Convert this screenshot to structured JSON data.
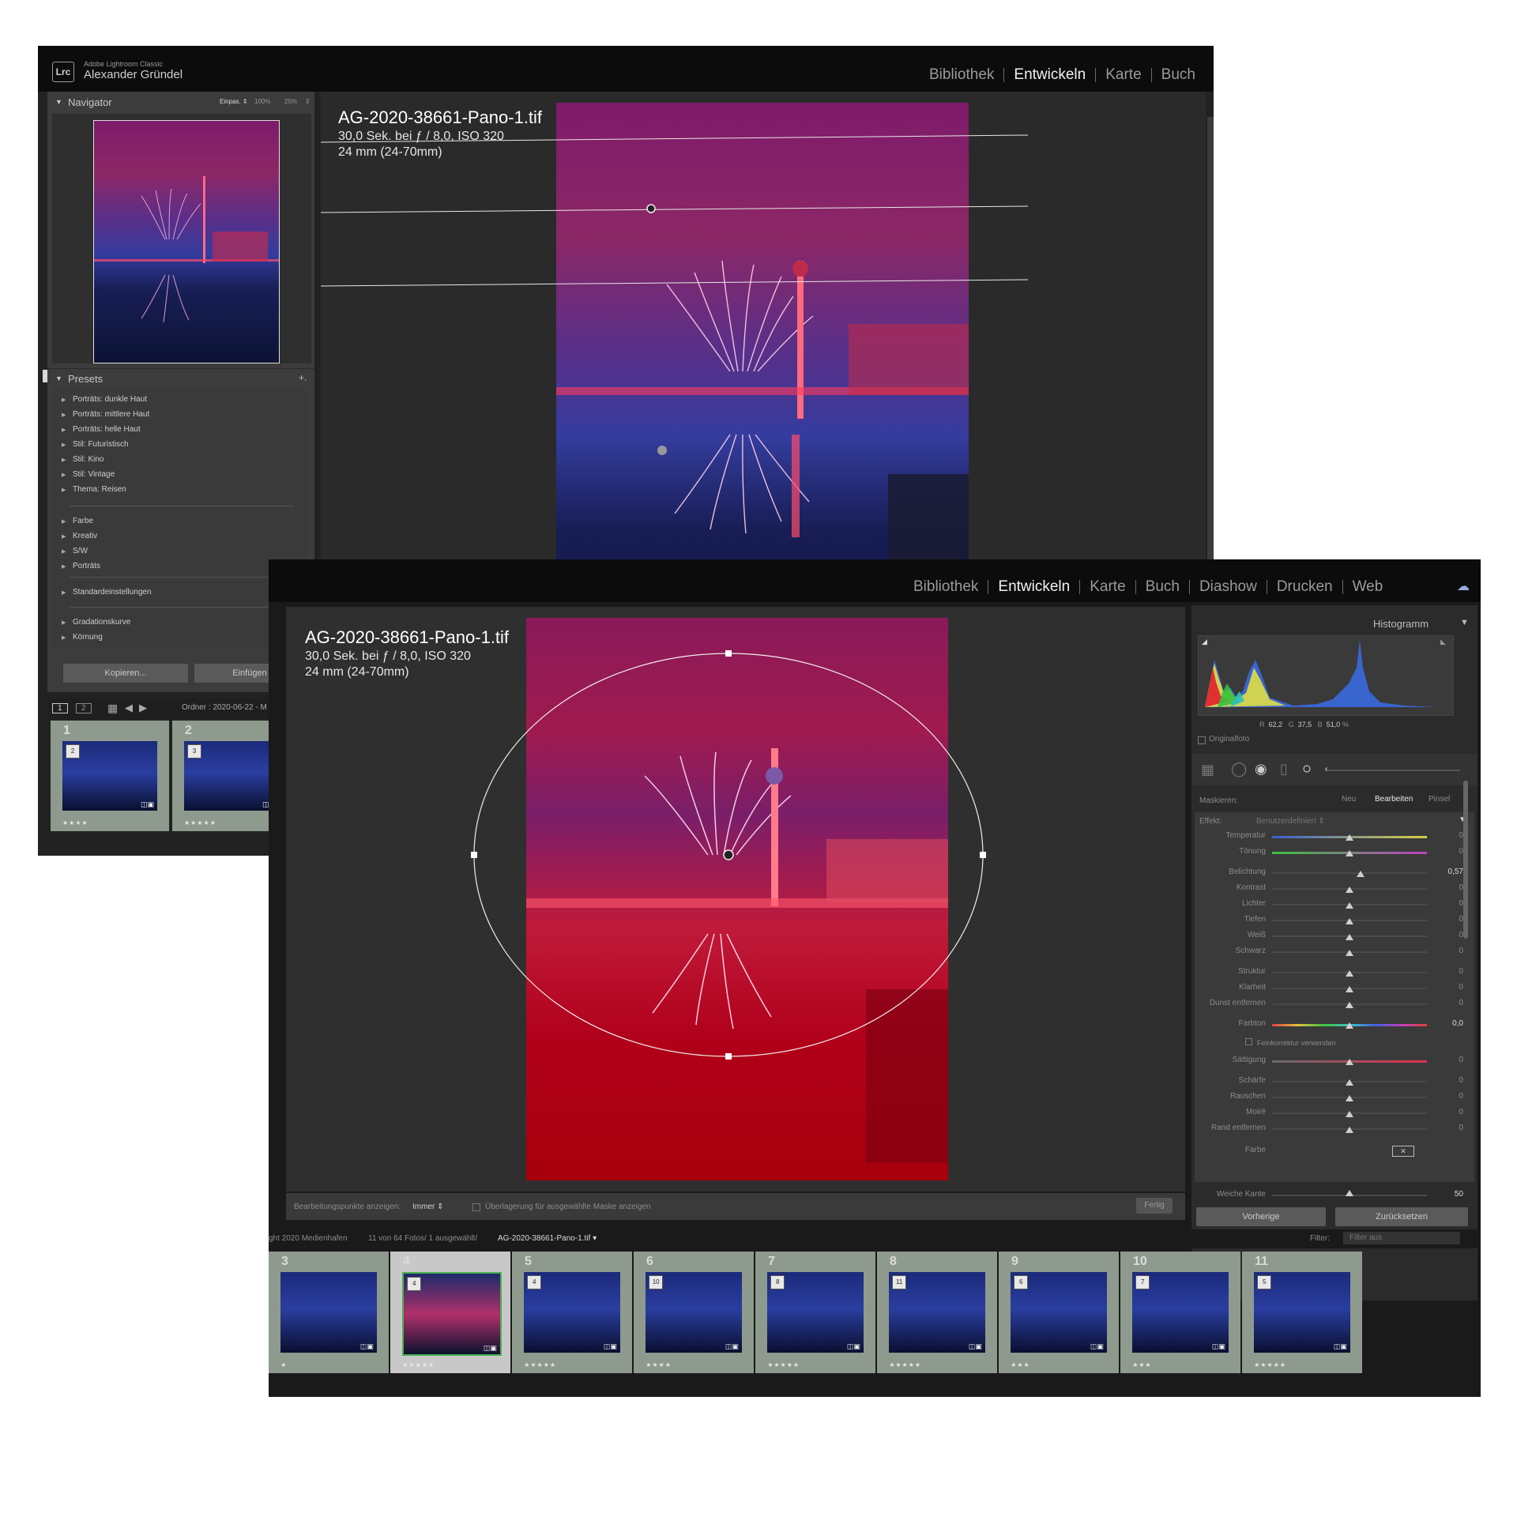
{
  "back_window": {
    "app_name": "Adobe Lightroom Classic",
    "user_name": "Alexander Gründel",
    "logo_text": "Lrc",
    "modules": [
      "Bibliothek",
      "Entwickeln",
      "Karte",
      "Buch"
    ],
    "active_module": "Entwickeln",
    "navigator": {
      "title": "Navigator",
      "zoom_fit": "Einpas. ⇕",
      "zoom_100": "100%",
      "zoom_25": "25%",
      "zoom_arrow": "⇕"
    },
    "presets": {
      "title": "Presets",
      "add_icon": "+.",
      "items_group1": [
        "Porträts: dunkle Haut",
        "Porträts: mittlere Haut",
        "Porträts: helle Haut",
        "Stil: Futuristisch",
        "Stil: Kino",
        "Stil: Vintage",
        "Thema: Reisen"
      ],
      "items_group2": [
        "Farbe",
        "Kreativ",
        "S/W",
        "Porträts"
      ],
      "items_group3": [
        "Standardeinstellungen"
      ],
      "items_group4": [
        "Gradationskurve",
        "Körnung"
      ]
    },
    "copy_button": "Kopieren...",
    "paste_button": "Einfügen",
    "filmstrip_bar": {
      "view1": "1",
      "view2": "2",
      "folder": "Ordner : 2020-06-22 - M"
    },
    "filmstrip": [
      {
        "number": "1",
        "badge": "2",
        "stars": "★★★★"
      },
      {
        "number": "2",
        "badge": "3",
        "stars": "★★★★★"
      }
    ],
    "file_name": "AG-2020-38661-Pano-1.tif",
    "exif_line1": "30,0 Sek. bei ƒ / 8,0, ISO 320",
    "exif_line2": "24 mm (24-70mm)"
  },
  "front_window": {
    "modules": [
      "Bibliothek",
      "Entwickeln",
      "Karte",
      "Buch",
      "Diashow",
      "Drucken",
      "Web"
    ],
    "active_module": "Entwickeln",
    "file_name": "AG-2020-38661-Pano-1.tif",
    "exif_line1": "30,0 Sek. bei ƒ / 8,0, ISO 320",
    "exif_line2": "24 mm (24-70mm)",
    "histogram": {
      "title": "Histogramm",
      "r_label": "R",
      "r_value": "62,2",
      "g_label": "G",
      "g_value": "37,5",
      "b_label": "B",
      "b_value": "51,0",
      "percent": "%",
      "original_label": "Originalfoto"
    },
    "mask": {
      "label": "Maskieren:",
      "new": "Neu",
      "edit": "Bearbeiten",
      "brush": "Pinsel"
    },
    "effect": {
      "label": "Effekt:",
      "value": "Benutzerdefiniert ⇕"
    },
    "sliders": [
      {
        "label": "Temperatur",
        "value": "0",
        "pos": 0.5,
        "gradient": "temp"
      },
      {
        "label": "Tönung",
        "value": "0",
        "pos": 0.5,
        "gradient": "tint"
      },
      {
        "label": "Belichtung",
        "value": "0,57",
        "pos": 0.57,
        "gradient": "none"
      },
      {
        "label": "Kontrast",
        "value": "0",
        "pos": 0.5,
        "gradient": "none"
      },
      {
        "label": "Lichter",
        "value": "0",
        "pos": 0.5,
        "gradient": "none"
      },
      {
        "label": "Tiefen",
        "value": "0",
        "pos": 0.5,
        "gradient": "none"
      },
      {
        "label": "Weiß",
        "value": "0",
        "pos": 0.5,
        "gradient": "none"
      },
      {
        "label": "Schwarz",
        "value": "0",
        "pos": 0.5,
        "gradient": "none"
      },
      {
        "label": "Struktur",
        "value": "0",
        "pos": 0.5,
        "gradient": "none"
      },
      {
        "label": "Klarheit",
        "value": "0",
        "pos": 0.5,
        "gradient": "none"
      },
      {
        "label": "Dunst entfernen",
        "value": "0",
        "pos": 0.5,
        "gradient": "none"
      },
      {
        "label": "Farbton",
        "value": "0,0",
        "pos": 0.5,
        "gradient": "hue"
      },
      {
        "label": "Sättigung",
        "value": "0",
        "pos": 0.5,
        "gradient": "sat"
      },
      {
        "label": "Schärfe",
        "value": "0",
        "pos": 0.5,
        "gradient": "none"
      },
      {
        "label": "Rauschen",
        "value": "0",
        "pos": 0.5,
        "gradient": "none"
      },
      {
        "label": "Moiré",
        "value": "0",
        "pos": 0.5,
        "gradient": "none"
      },
      {
        "label": "Rand entfernen",
        "value": "0",
        "pos": 0.5,
        "gradient": "none"
      }
    ],
    "fine_adjust_label": "Feinkorrektur verwenden",
    "color_label": "Farbe",
    "feather": {
      "label": "Weiche Kante",
      "value": "50",
      "pos": 0.5
    },
    "previous_button": "Vorherige",
    "reset_button": "Zurücksetzen",
    "toolbar": {
      "show_points_label": "Bearbeitungspunkte anzeigen:",
      "show_points_value": "Immer ⇕",
      "overlay_label": "Überlagerung für ausgewählte Maske anzeigen",
      "done_button": "Fertig"
    },
    "filmstrip_info": {
      "collection": "ght 2020 Medienhafen",
      "count": "11 von 64 Fotos/ 1 ausgewählt/",
      "selected_file": "AG-2020-38661-Pano-1.tif ▾",
      "filter_label": "Filter:",
      "filter_value": "Filter aus"
    },
    "filmstrip": [
      {
        "number": "3",
        "badge": "",
        "stars": "★"
      },
      {
        "number": "4",
        "badge": "4",
        "stars": "★★★★★"
      },
      {
        "number": "5",
        "badge": "4",
        "stars": "★★★★★"
      },
      {
        "number": "6",
        "badge": "10",
        "stars": "★★★★"
      },
      {
        "number": "7",
        "badge": "8",
        "stars": "★★★★★"
      },
      {
        "number": "8",
        "badge": "11",
        "stars": "★★★★★"
      },
      {
        "number": "9",
        "badge": "6",
        "stars": "★★★"
      },
      {
        "number": "10",
        "badge": "7",
        "stars": "★★★"
      },
      {
        "number": "11",
        "badge": "5",
        "stars": "★★★★★"
      }
    ]
  },
  "colors": {
    "mask_overlay": "#c8001e",
    "accent_selected": "#4caf50",
    "panel_bg": "#2b2b2b"
  }
}
